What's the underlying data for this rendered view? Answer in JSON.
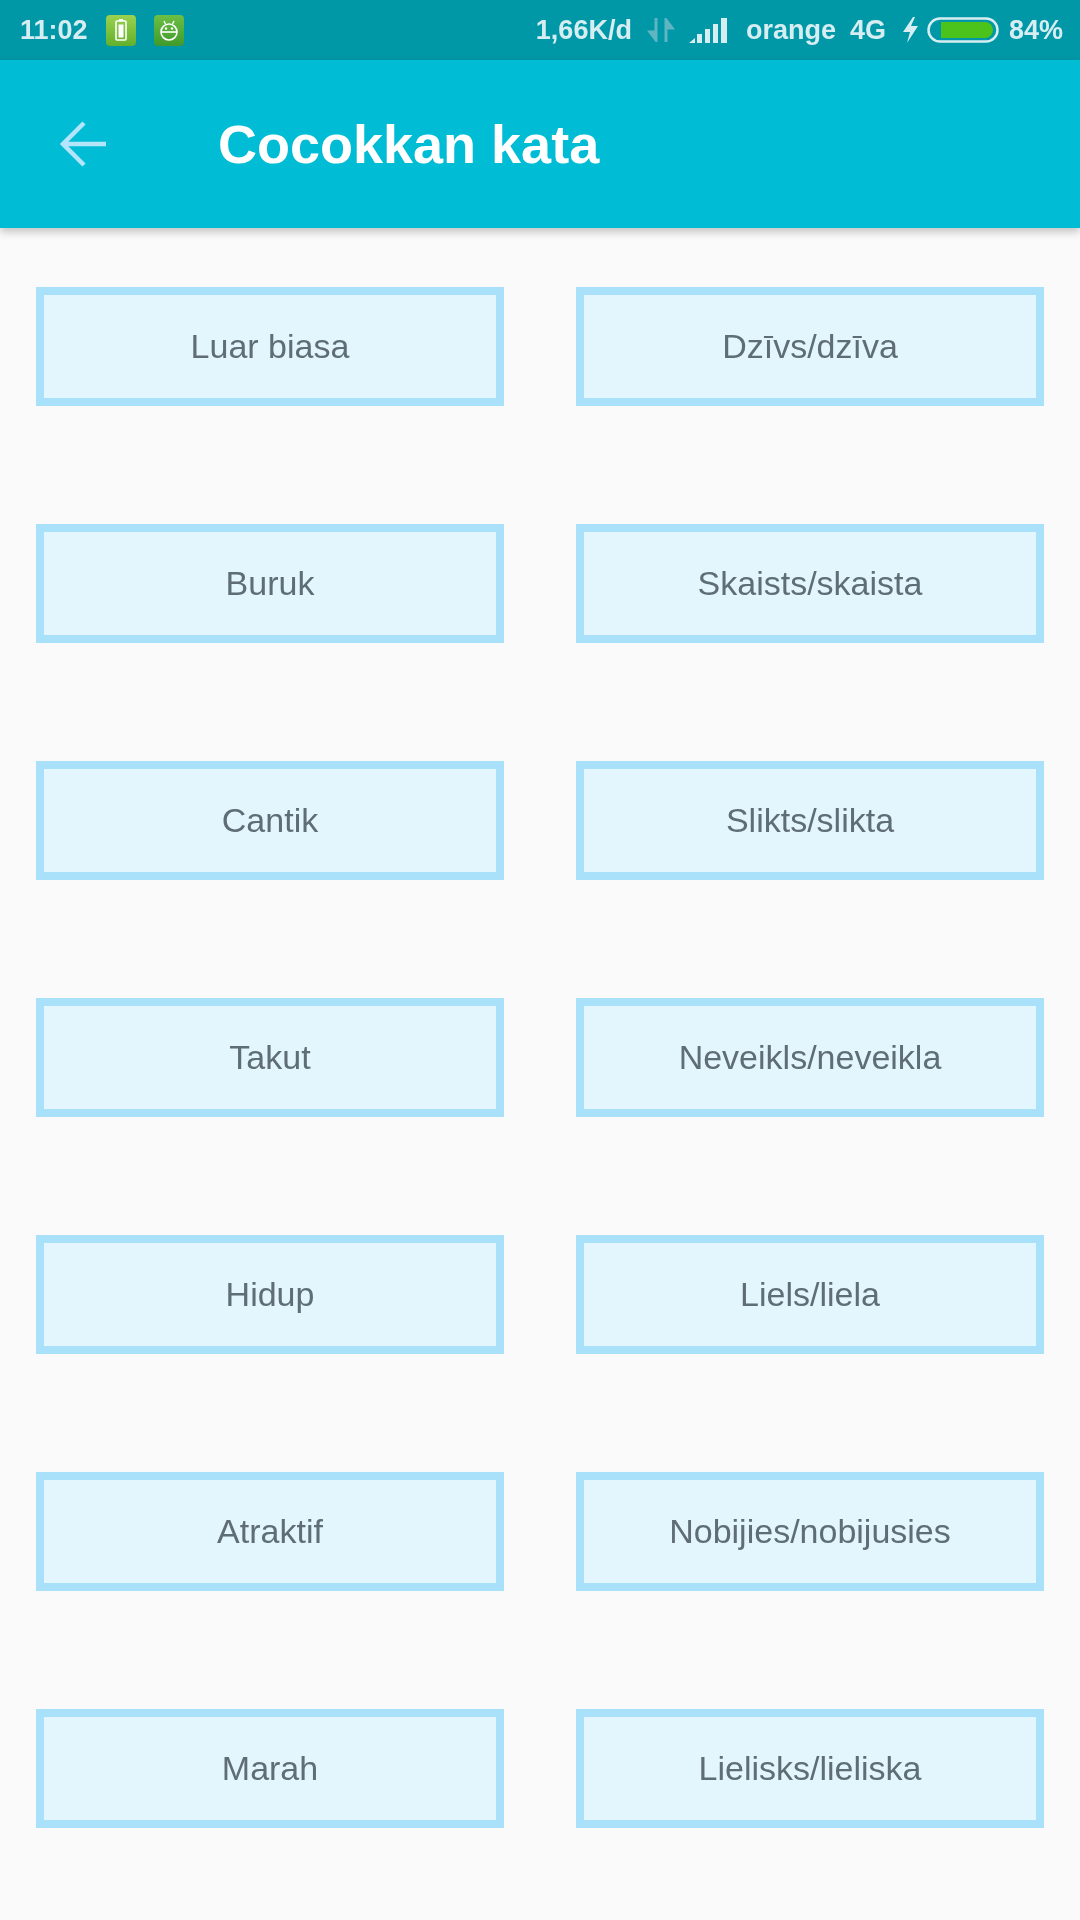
{
  "status_bar": {
    "time": "11:02",
    "network_speed": "1,66K/d",
    "carrier": "orange",
    "network_type": "4G",
    "charging": true,
    "battery_percent": "84%"
  },
  "app_bar": {
    "title": "Cocokkan kata"
  },
  "cards": [
    "Luar biasa",
    "Dzīvs/dzīva",
    "Buruk",
    "Skaists/skaista",
    "Cantik",
    "Slikts/slikta",
    "Takut",
    "Neveikls/neveikla",
    "Hidup",
    "Liels/liela",
    "Atraktif",
    "Nobijies/nobijusies",
    "Marah",
    "Lielisks/lieliska"
  ]
}
